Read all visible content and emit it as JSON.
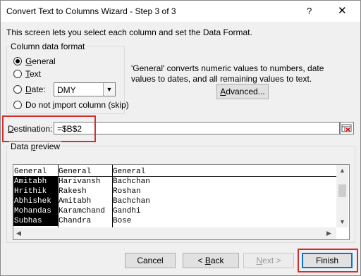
{
  "window": {
    "title": "Convert Text to Columns Wizard - Step 3 of 3",
    "help_glyph": "?",
    "close_glyph": "✕"
  },
  "intro": "This screen lets you select each column and set the Data Format.",
  "format": {
    "legend": "Column data format",
    "general_label": "General",
    "text_label": "Text",
    "date_label": "Date:",
    "date_value": "DMY",
    "skip_label": "Do not import column (skip)",
    "selected": "General"
  },
  "info_text": "'General' converts numeric values to numbers, date values to dates, and all remaining values to text.",
  "advanced_label": "Advanced...",
  "destination": {
    "label": "Destination:",
    "value": "=$B$2"
  },
  "preview": {
    "legend": "Data preview",
    "headers": [
      "General",
      "General",
      "General"
    ],
    "rows": [
      [
        "Amitabh",
        "Harivansh",
        "Bachchan"
      ],
      [
        "Hrithik",
        "Rakesh",
        "Roshan"
      ],
      [
        "Abhishek",
        "Amitabh",
        "Bachchan"
      ],
      [
        "Mohandas",
        "Karamchand",
        "Gandhi"
      ],
      [
        "Subhas",
        "Chandra",
        "Bose"
      ]
    ]
  },
  "buttons": {
    "cancel": "Cancel",
    "back": "< Back",
    "next": "Next >",
    "finish": "Finish"
  },
  "colors": {
    "highlight": "#d62d2d",
    "focus_border": "#0078d7"
  }
}
